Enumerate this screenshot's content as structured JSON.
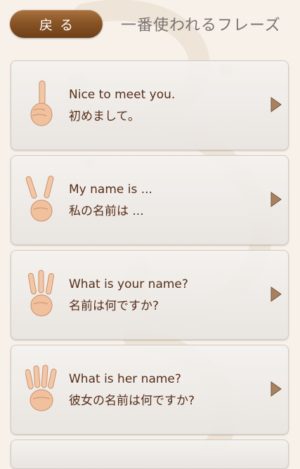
{
  "header": {
    "back_label": "戻る",
    "title": "一番使われるフレーズ"
  },
  "phrases": [
    {
      "en": "Nice to meet you.",
      "jp": "初めまして。",
      "icon": "one-finger-hand-icon",
      "fingers": 1
    },
    {
      "en": "My name is ...",
      "jp": "私の名前は ...",
      "icon": "two-finger-hand-icon",
      "fingers": 2
    },
    {
      "en": "What is your name?",
      "jp": "名前は何ですか?",
      "icon": "three-finger-hand-icon",
      "fingers": 3
    },
    {
      "en": "What is her name?",
      "jp": "彼女の名前は何ですか?",
      "icon": "four-finger-hand-icon",
      "fingers": 4
    }
  ],
  "colors": {
    "background": "#f7f1ea",
    "back_button": "#8a5526",
    "text": "#4a1f08",
    "title": "#7c7370",
    "arrow": "#a07958"
  }
}
